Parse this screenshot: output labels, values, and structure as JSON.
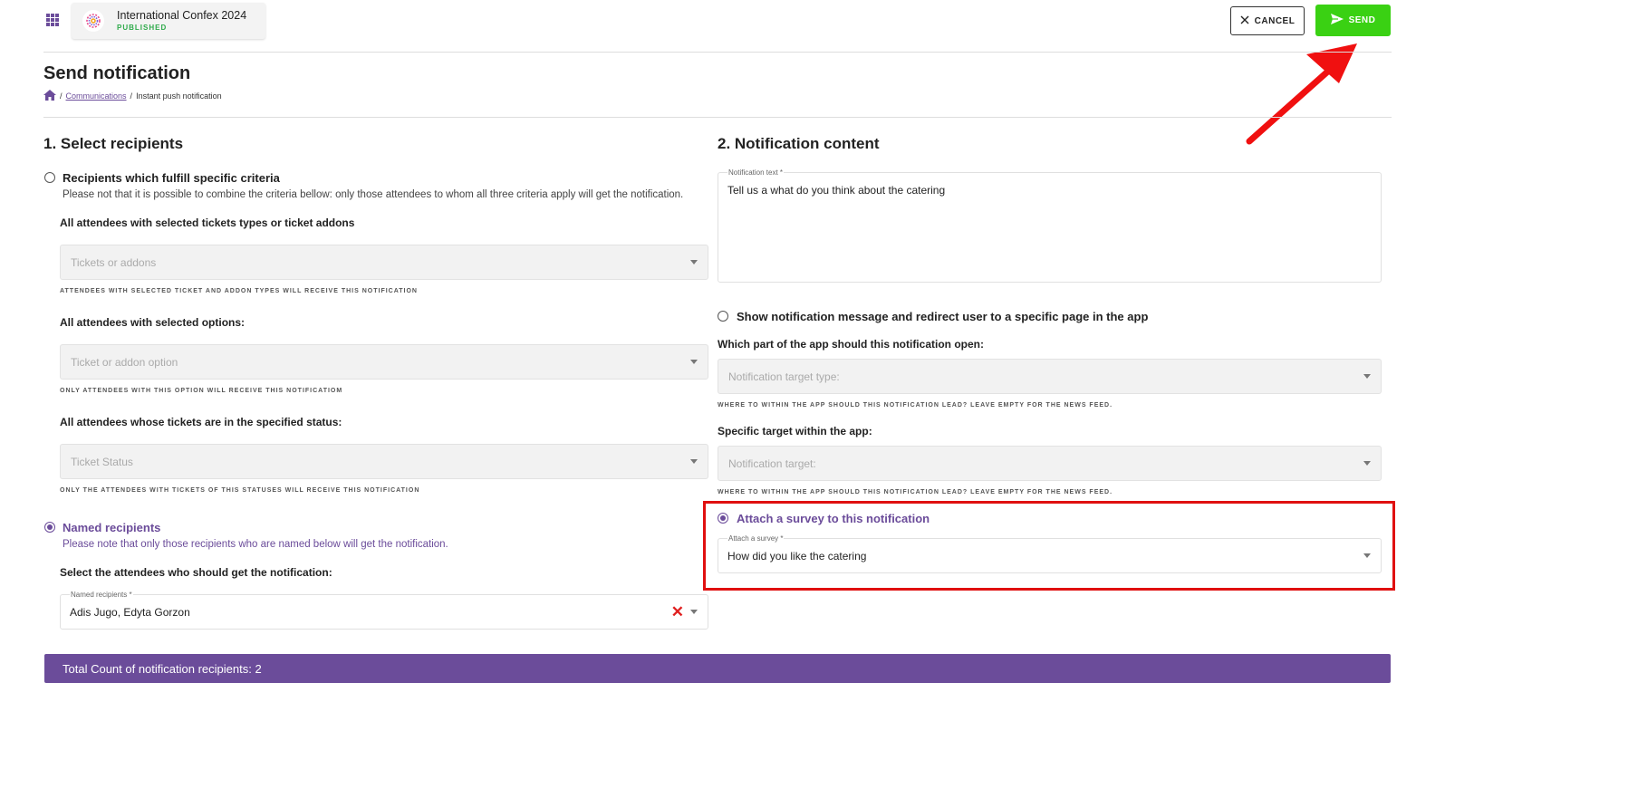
{
  "header": {
    "event_title": "International Confex 2024",
    "event_status": "PUBLISHED",
    "cancel_label": "CANCEL",
    "send_label": "SEND"
  },
  "page": {
    "title": "Send notification",
    "breadcrumb": [
      "Communications",
      "Instant push notification"
    ]
  },
  "recipients": {
    "heading": "1. Select recipients",
    "criteria_option": {
      "label": "Recipients which fulfill specific criteria",
      "description": "Please not that it is possible to combine the criteria bellow: only those attendees to whom all three criteria apply will get the notification.",
      "selected": false
    },
    "tickets": {
      "label": "All attendees with selected tickets types or ticket addons",
      "placeholder": "Tickets or addons",
      "hint": "Attendees with selected ticket and addon types will receive this notification"
    },
    "options": {
      "label": "All attendees with selected options:",
      "placeholder": "Ticket or addon option",
      "hint": "Only attendees with this option will receive this notificatiom"
    },
    "status": {
      "label": "All attendees whose tickets are in the specified status:",
      "placeholder": "Ticket Status",
      "hint": "Only the attendees with tickets of this statuses will receive this notification"
    },
    "named_option": {
      "label": "Named recipients",
      "description": "Please note that only those recipients who are named below will get the notification.",
      "selected": true
    },
    "named_select": {
      "label": "Select the attendees who should get the notification:",
      "field_label": "Named recipients *",
      "value": "Adis Jugo, Edyta Gorzon"
    }
  },
  "content": {
    "heading": "2. Notification content",
    "text_field_label": "Notification text *",
    "text_value": "Tell us a what do you think about the catering",
    "redirect_option": {
      "label": "Show notification message and redirect user to a specific page in the app",
      "selected": false
    },
    "target_type": {
      "label": "Which part of the app should this notification open:",
      "placeholder": "Notification target type:",
      "hint": "Where to within the app should this notification lead? Leave empty for the news feed."
    },
    "target": {
      "label": "Specific target within the app:",
      "placeholder": "Notification target:",
      "hint": "Where to within the app should this notification lead? Leave empty for the news feed."
    },
    "survey_option": {
      "label": "Attach a survey to this notification",
      "selected": true
    },
    "survey_select": {
      "field_label": "Attach a survey *",
      "value": "How did you like the catering"
    }
  },
  "footer": {
    "total_label": "Total Count of notification recipients: 2"
  },
  "colors": {
    "accent": "#6b4c9a",
    "send": "#3ad113",
    "highlight": "#e01010"
  }
}
